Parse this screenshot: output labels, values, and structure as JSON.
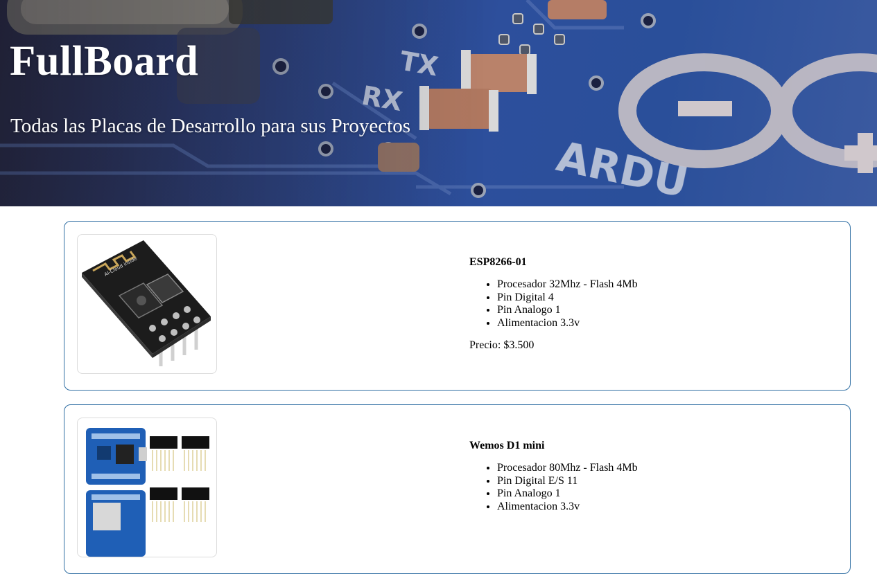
{
  "header": {
    "title": "FullBoard",
    "subtitle": "Todas las Placas de Desarrollo para sus Proyectos",
    "background_image": "arduino-board-closeup",
    "board_markings": [
      "RX",
      "TX",
      "ARDU"
    ]
  },
  "products": [
    {
      "name": "ESP8266-01",
      "image": "esp8266-01-module",
      "image_marking": "AI-Cloud inside",
      "specs": [
        "Procesador 32Mhz - Flash 4Mb",
        "Pin Digital 4",
        "Pin Analogo 1",
        "Alimentacion 3.3v"
      ],
      "price": "Precio: $3.500"
    },
    {
      "name": "Wemos D1 mini",
      "image": "wemos-d1-mini-board",
      "specs": [
        "Procesador 80Mhz - Flash 4Mb",
        "Pin Digital E/S 11",
        "Pin Analogo 1",
        "Alimentacion 3.3v"
      ]
    }
  ],
  "colors": {
    "card_border": "#2f6ea3",
    "header_text": "#ffffff",
    "board_blue": "#2a4f9a"
  }
}
